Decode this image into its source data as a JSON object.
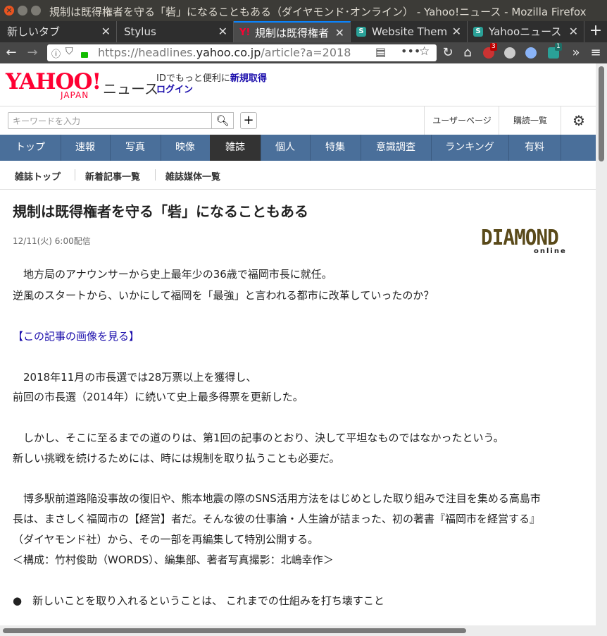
{
  "window": {
    "title": "規制は既得権者を守る「砦」になることもある（ダイヤモンド･オンライン） - Yahoo!ニュース - Mozilla Firefox"
  },
  "tabs": [
    {
      "label": "新しいタブ",
      "close": "✕"
    },
    {
      "label": "Stylus",
      "close": "✕"
    },
    {
      "label": "規制は既得権者",
      "close": "✕"
    },
    {
      "label": "Website Them",
      "close": "✕"
    },
    {
      "label": "Yahooニュース",
      "close": "✕"
    }
  ],
  "nav": {
    "url_prefix": "https://headlines.",
    "url_domain": "yahoo.co.jp",
    "url_suffix": "/article?a=2018",
    "badge_a": "3",
    "badge_b": "1"
  },
  "header": {
    "logo_main": "YAHOO!",
    "logo_sub": "JAPAN",
    "logo_news": "ニュース",
    "id_text": "IDでもっと便利に",
    "id_link": "新規取得",
    "login": "ログイン",
    "search_placeholder": "キーワードを入力",
    "user_page": "ユーザーページ",
    "purchases": "購読一覧"
  },
  "categories": [
    "トップ",
    "速報",
    "写真",
    "映像",
    "雑誌",
    "個人",
    "特集",
    "意識調査",
    "ランキング",
    "有料"
  ],
  "subnav": [
    "雑誌トップ",
    "新着記事一覧",
    "雑誌媒体一覧"
  ],
  "article": {
    "title": "規制は既得権者を守る「砦」になることもある",
    "date": "12/11(火) 6:00配信",
    "publisher_main": "DIAMOND",
    "publisher_sub": "online",
    "p1_l1": "　地方局のアナウンサーから史上最年少の36歳で福岡市長に就任。",
    "p1_l2": "逆風のスタートから、いかにして福岡を「最強」と言われる都市に改革していったのか？",
    "image_link": "【この記事の画像を見る】",
    "p2_l1": "　2018年11月の市長選では28万票以上を獲得し、",
    "p2_l2": "前回の市長選（2014年）に続いて史上最多得票を更新した。",
    "p3_l1": "　しかし、そこに至るまでの道のりは、第1回の記事のとおり、決して平坦なものではなかったという。",
    "p3_l2": "新しい挑戦を続けるためには、時には規制を取り払うことも必要だ。",
    "p4_l1": "　博多駅前道路陥没事故の復旧や、熊本地震の際のSNS活用方法をはじめとした取り組みで注目を集める高島市",
    "p4_l2": "長は、まさしく福岡市の【経営】者だ。そんな彼の仕事論・人生論が詰まった、初の著書『福岡市を経営する』",
    "p4_l3": "（ダイヤモンド社）から、その一部を再編集して特別公開する。",
    "p4_l4": "＜構成：竹村俊助（WORDS）、編集部、著者写真撮影：北嶋幸作＞",
    "bullet": "●　新しいことを取り入れるということは、 これまでの仕組みを打ち壊すこと"
  }
}
